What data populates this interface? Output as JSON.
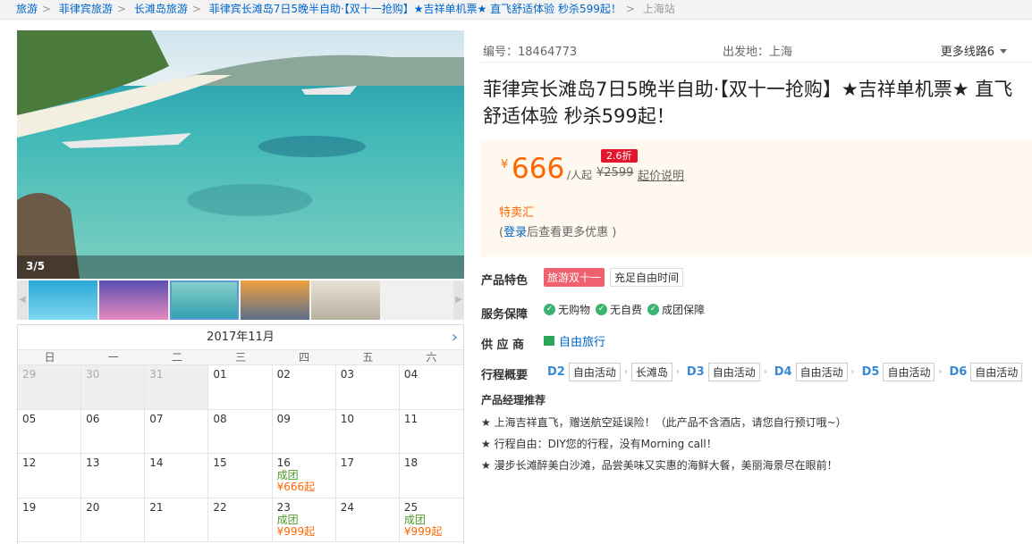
{
  "breadcrumb": [
    "旅游",
    "菲律宾旅游",
    "长滩岛旅游",
    "菲律宾长滩岛7日5晚半自助·【双十一抢购】★吉祥单机票★ 直飞舒适体验 秒杀599起！",
    "上海站"
  ],
  "gallery": {
    "counter": "3/5",
    "thumb_count": 5,
    "selected_thumb": 3
  },
  "calendar": {
    "month": "2017年11月",
    "weekdays": [
      "日",
      "一",
      "二",
      "三",
      "四",
      "五",
      "六"
    ],
    "weeks": [
      [
        {
          "d": "29",
          "prev": true
        },
        {
          "d": "30",
          "prev": true
        },
        {
          "d": "31",
          "prev": true
        },
        {
          "d": "01"
        },
        {
          "d": "02"
        },
        {
          "d": "03"
        },
        {
          "d": "04"
        }
      ],
      [
        {
          "d": "05"
        },
        {
          "d": "06"
        },
        {
          "d": "07"
        },
        {
          "d": "08"
        },
        {
          "d": "09"
        },
        {
          "d": "10"
        },
        {
          "d": "11"
        }
      ],
      [
        {
          "d": "12"
        },
        {
          "d": "13"
        },
        {
          "d": "14"
        },
        {
          "d": "15"
        },
        {
          "d": "16",
          "status": "成团",
          "price": "¥666起"
        },
        {
          "d": "17"
        },
        {
          "d": "18"
        }
      ],
      [
        {
          "d": "19"
        },
        {
          "d": "20"
        },
        {
          "d": "21"
        },
        {
          "d": "22"
        },
        {
          "d": "23",
          "status": "成团",
          "price": "¥999起"
        },
        {
          "d": "24"
        },
        {
          "d": "25",
          "status": "成团",
          "price": "¥999起"
        }
      ]
    ]
  },
  "meta": {
    "code": "编号：18464773",
    "departure": "出发地：上海",
    "more_routes": "更多线路6"
  },
  "title": "菲律宾长滩岛7日5晚半自助·【双十一抢购】★吉祥单机票★ 直飞舒适体验 秒杀599起！",
  "price": {
    "currency": "¥",
    "value": "666",
    "unit": "/人起",
    "original": "¥2599",
    "discount": "2.6折",
    "explain": "起价说明",
    "tmh": "特卖汇",
    "login_prefix": "(",
    "login_link": "登录",
    "login_suffix": "后查看更多优惠 )"
  },
  "features": {
    "label": "产品特色",
    "tags": [
      "旅游双十一",
      "充足自由时间"
    ]
  },
  "guarantee": {
    "label": "服务保障",
    "items": [
      "无购物",
      "无自费",
      "成团保障"
    ]
  },
  "supplier": {
    "label": "供 应 商",
    "name": "自由旅行"
  },
  "itinerary": {
    "label": "行程概要",
    "items": [
      {
        "day": "D2",
        "acts": [
          "自由活动",
          "长滩岛"
        ]
      },
      {
        "day": "D3",
        "acts": [
          "自由活动"
        ]
      },
      {
        "day": "D4",
        "acts": [
          "自由活动"
        ]
      },
      {
        "day": "D5",
        "acts": [
          "自由活动"
        ]
      },
      {
        "day": "D6",
        "acts": [
          "自由活动"
        ]
      }
    ]
  },
  "pm": {
    "title": "产品经理推荐",
    "lines": [
      "★ 上海吉祥直飞，赠送航空延误险！（此产品不含酒店，请您自行预订哦~）",
      "★ 行程自由：DIY您的行程，没有Morning call！",
      "★ 漫步长滩醉美白沙滩，品尝美味又实惠的海鲜大餐，美丽海景尽在眼前！"
    ]
  },
  "colors": {
    "link": "#0066cc",
    "price": "#ff6600",
    "accent_blue": "#3a89d6",
    "discount": "#e4162c"
  }
}
